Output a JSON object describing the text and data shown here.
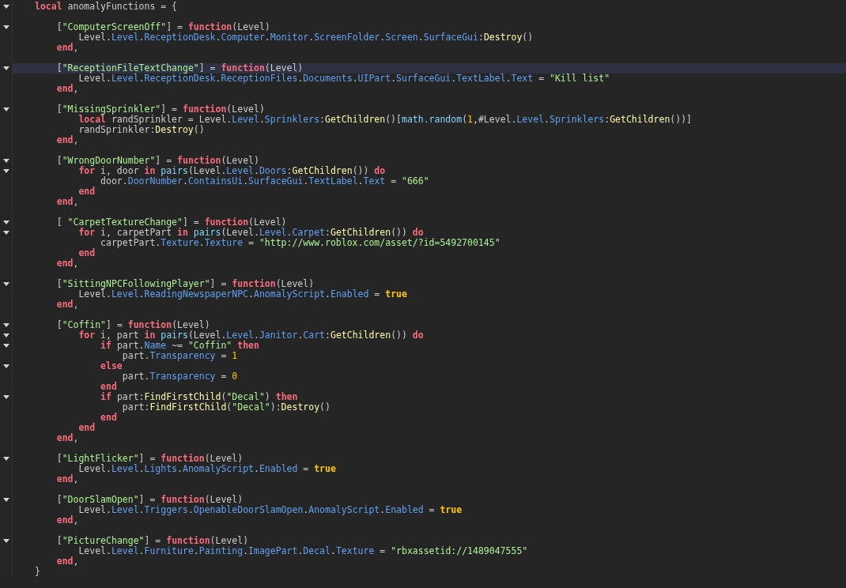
{
  "editor": {
    "lines": [
      {
        "fold": true,
        "current": false,
        "tokens": [
          {
            "kind": "keyword",
            "text": "local"
          },
          {
            "kind": "plain",
            "text": " anomalyFunctions = {"
          }
        ]
      },
      {
        "fold": false,
        "current": false
      },
      {
        "fold": true,
        "current": false,
        "tokens": [
          {
            "kind": "plain",
            "text": "\t["
          },
          {
            "kind": "string",
            "text": "\"ComputerScreenOff\""
          },
          {
            "kind": "plain",
            "text": "] = "
          },
          {
            "kind": "keyword",
            "text": "function"
          },
          {
            "kind": "plain",
            "text": "(Level)"
          }
        ]
      },
      {
        "fold": false,
        "current": false,
        "tokens": [
          {
            "kind": "plain",
            "text": "\t\tLevel."
          },
          {
            "kind": "property",
            "text": "Level"
          },
          {
            "kind": "plain",
            "text": "."
          },
          {
            "kind": "property",
            "text": "ReceptionDesk"
          },
          {
            "kind": "plain",
            "text": "."
          },
          {
            "kind": "property",
            "text": "Computer"
          },
          {
            "kind": "plain",
            "text": "."
          },
          {
            "kind": "property",
            "text": "Monitor"
          },
          {
            "kind": "plain",
            "text": "."
          },
          {
            "kind": "property",
            "text": "ScreenFolder"
          },
          {
            "kind": "plain",
            "text": "."
          },
          {
            "kind": "property",
            "text": "Screen"
          },
          {
            "kind": "plain",
            "text": "."
          },
          {
            "kind": "property",
            "text": "SurfaceGui"
          },
          {
            "kind": "plain",
            "text": ":"
          },
          {
            "kind": "method",
            "text": "Destroy"
          },
          {
            "kind": "plain",
            "text": "()"
          }
        ]
      },
      {
        "fold": false,
        "current": false,
        "tokens": [
          {
            "kind": "keyword",
            "text": "\tend"
          },
          {
            "kind": "plain",
            "text": ","
          }
        ]
      },
      {
        "fold": false,
        "current": false
      },
      {
        "fold": true,
        "current": true,
        "tokens": [
          {
            "kind": "plain",
            "text": "\t["
          },
          {
            "kind": "string",
            "text": "\"ReceptionFileTextChange\""
          },
          {
            "kind": "plain",
            "text": "] = "
          },
          {
            "kind": "keyword",
            "text": "function"
          },
          {
            "kind": "plain",
            "text": "(Level)"
          }
        ]
      },
      {
        "fold": false,
        "current": false,
        "tokens": [
          {
            "kind": "plain",
            "text": "\t\tLevel."
          },
          {
            "kind": "property",
            "text": "Level"
          },
          {
            "kind": "plain",
            "text": "."
          },
          {
            "kind": "property",
            "text": "ReceptionDesk"
          },
          {
            "kind": "plain",
            "text": "."
          },
          {
            "kind": "property",
            "text": "ReceptionFiles"
          },
          {
            "kind": "plain",
            "text": "."
          },
          {
            "kind": "property",
            "text": "Documents"
          },
          {
            "kind": "plain",
            "text": "."
          },
          {
            "kind": "property",
            "text": "UIPart"
          },
          {
            "kind": "plain",
            "text": "."
          },
          {
            "kind": "property",
            "text": "SurfaceGui"
          },
          {
            "kind": "plain",
            "text": "."
          },
          {
            "kind": "property",
            "text": "TextLabel"
          },
          {
            "kind": "plain",
            "text": "."
          },
          {
            "kind": "property",
            "text": "Text"
          },
          {
            "kind": "plain",
            "text": " = "
          },
          {
            "kind": "string",
            "text": "\"Kill list\""
          }
        ]
      },
      {
        "fold": false,
        "current": false,
        "tokens": [
          {
            "kind": "keyword",
            "text": "\tend"
          },
          {
            "kind": "plain",
            "text": ","
          }
        ]
      },
      {
        "fold": false,
        "current": false
      },
      {
        "fold": true,
        "current": false,
        "tokens": [
          {
            "kind": "plain",
            "text": "\t["
          },
          {
            "kind": "string",
            "text": "\"MissingSprinkler\""
          },
          {
            "kind": "plain",
            "text": "] = "
          },
          {
            "kind": "keyword",
            "text": "function"
          },
          {
            "kind": "plain",
            "text": "(Level)"
          }
        ]
      },
      {
        "fold": false,
        "current": false,
        "tokens": [
          {
            "kind": "keyword",
            "text": "\t\tlocal"
          },
          {
            "kind": "plain",
            "text": " randSprinkler = Level."
          },
          {
            "kind": "property",
            "text": "Level"
          },
          {
            "kind": "plain",
            "text": "."
          },
          {
            "kind": "property",
            "text": "Sprinklers"
          },
          {
            "kind": "plain",
            "text": ":"
          },
          {
            "kind": "method",
            "text": "GetChildren"
          },
          {
            "kind": "plain",
            "text": "()["
          },
          {
            "kind": "builtin",
            "text": "math.random"
          },
          {
            "kind": "plain",
            "text": "("
          },
          {
            "kind": "number",
            "text": "1"
          },
          {
            "kind": "plain",
            "text": ",#Level."
          },
          {
            "kind": "property",
            "text": "Level"
          },
          {
            "kind": "plain",
            "text": "."
          },
          {
            "kind": "property",
            "text": "Sprinklers"
          },
          {
            "kind": "plain",
            "text": ":"
          },
          {
            "kind": "method",
            "text": "GetChildren"
          },
          {
            "kind": "plain",
            "text": "())]"
          }
        ]
      },
      {
        "fold": false,
        "current": false,
        "tokens": [
          {
            "kind": "plain",
            "text": "\t\trandSprinkler:"
          },
          {
            "kind": "method",
            "text": "Destroy"
          },
          {
            "kind": "plain",
            "text": "()"
          }
        ]
      },
      {
        "fold": false,
        "current": false,
        "tokens": [
          {
            "kind": "keyword",
            "text": "\tend"
          },
          {
            "kind": "plain",
            "text": ","
          }
        ]
      },
      {
        "fold": false,
        "current": false
      },
      {
        "fold": true,
        "current": false,
        "tokens": [
          {
            "kind": "plain",
            "text": "\t["
          },
          {
            "kind": "string",
            "text": "\"WrongDoorNumber\""
          },
          {
            "kind": "plain",
            "text": "] = "
          },
          {
            "kind": "keyword",
            "text": "function"
          },
          {
            "kind": "plain",
            "text": "(Level)"
          }
        ]
      },
      {
        "fold": true,
        "current": false,
        "tokens": [
          {
            "kind": "keyword",
            "text": "\t\tfor"
          },
          {
            "kind": "plain",
            "text": " i, door "
          },
          {
            "kind": "keyword",
            "text": "in"
          },
          {
            "kind": "builtin",
            "text": " pairs"
          },
          {
            "kind": "plain",
            "text": "(Level."
          },
          {
            "kind": "property",
            "text": "Level"
          },
          {
            "kind": "plain",
            "text": "."
          },
          {
            "kind": "property",
            "text": "Doors"
          },
          {
            "kind": "plain",
            "text": ":"
          },
          {
            "kind": "method",
            "text": "GetChildren"
          },
          {
            "kind": "plain",
            "text": "()) "
          },
          {
            "kind": "keyword",
            "text": "do"
          }
        ]
      },
      {
        "fold": false,
        "current": false,
        "tokens": [
          {
            "kind": "plain",
            "text": "\t\t\tdoor."
          },
          {
            "kind": "property",
            "text": "DoorNumber"
          },
          {
            "kind": "plain",
            "text": "."
          },
          {
            "kind": "property",
            "text": "ContainsUi"
          },
          {
            "kind": "plain",
            "text": "."
          },
          {
            "kind": "property",
            "text": "SurfaceGui"
          },
          {
            "kind": "plain",
            "text": "."
          },
          {
            "kind": "property",
            "text": "TextLabel"
          },
          {
            "kind": "plain",
            "text": "."
          },
          {
            "kind": "property",
            "text": "Text"
          },
          {
            "kind": "plain",
            "text": " = "
          },
          {
            "kind": "string",
            "text": "\"666\""
          }
        ]
      },
      {
        "fold": false,
        "current": false,
        "tokens": [
          {
            "kind": "keyword",
            "text": "\t\tend"
          }
        ]
      },
      {
        "fold": false,
        "current": false,
        "tokens": [
          {
            "kind": "keyword",
            "text": "\tend"
          },
          {
            "kind": "plain",
            "text": ","
          }
        ]
      },
      {
        "fold": false,
        "current": false
      },
      {
        "fold": true,
        "current": false,
        "tokens": [
          {
            "kind": "plain",
            "text": "\t[ "
          },
          {
            "kind": "string",
            "text": "\"CarpetTextureChange\""
          },
          {
            "kind": "plain",
            "text": "] = "
          },
          {
            "kind": "keyword",
            "text": "function"
          },
          {
            "kind": "plain",
            "text": "(Level)"
          }
        ]
      },
      {
        "fold": true,
        "current": false,
        "tokens": [
          {
            "kind": "keyword",
            "text": "\t\tfor"
          },
          {
            "kind": "plain",
            "text": " i, carpetPart "
          },
          {
            "kind": "keyword",
            "text": "in"
          },
          {
            "kind": "builtin",
            "text": " pairs"
          },
          {
            "kind": "plain",
            "text": "(Level."
          },
          {
            "kind": "property",
            "text": "Level"
          },
          {
            "kind": "plain",
            "text": "."
          },
          {
            "kind": "property",
            "text": "Carpet"
          },
          {
            "kind": "plain",
            "text": ":"
          },
          {
            "kind": "method",
            "text": "GetChildren"
          },
          {
            "kind": "plain",
            "text": "()) "
          },
          {
            "kind": "keyword",
            "text": "do"
          }
        ]
      },
      {
        "fold": false,
        "current": false,
        "tokens": [
          {
            "kind": "plain",
            "text": "\t\t\tcarpetPart."
          },
          {
            "kind": "property",
            "text": "Texture"
          },
          {
            "kind": "plain",
            "text": "."
          },
          {
            "kind": "property",
            "text": "Texture"
          },
          {
            "kind": "plain",
            "text": " = "
          },
          {
            "kind": "string",
            "text": "\"http://www.roblox.com/asset/?id=5492700145\""
          }
        ]
      },
      {
        "fold": false,
        "current": false,
        "tokens": [
          {
            "kind": "keyword",
            "text": "\t\tend"
          }
        ]
      },
      {
        "fold": false,
        "current": false,
        "tokens": [
          {
            "kind": "keyword",
            "text": "\tend"
          },
          {
            "kind": "plain",
            "text": ","
          }
        ]
      },
      {
        "fold": false,
        "current": false
      },
      {
        "fold": true,
        "current": false,
        "tokens": [
          {
            "kind": "plain",
            "text": "\t["
          },
          {
            "kind": "string",
            "text": "\"SittingNPCFollowingPlayer\""
          },
          {
            "kind": "plain",
            "text": "] = "
          },
          {
            "kind": "keyword",
            "text": "function"
          },
          {
            "kind": "plain",
            "text": "(Level)"
          }
        ]
      },
      {
        "fold": false,
        "current": false,
        "tokens": [
          {
            "kind": "plain",
            "text": "\t\tLevel."
          },
          {
            "kind": "property",
            "text": "Level"
          },
          {
            "kind": "plain",
            "text": "."
          },
          {
            "kind": "property",
            "text": "ReadingNewspaperNPC"
          },
          {
            "kind": "plain",
            "text": "."
          },
          {
            "kind": "property",
            "text": "AnomalyScript"
          },
          {
            "kind": "plain",
            "text": "."
          },
          {
            "kind": "property",
            "text": "Enabled"
          },
          {
            "kind": "plain",
            "text": " = "
          },
          {
            "kind": "boolean",
            "text": "true"
          }
        ]
      },
      {
        "fold": false,
        "current": false,
        "tokens": [
          {
            "kind": "keyword",
            "text": "\tend"
          },
          {
            "kind": "plain",
            "text": ","
          }
        ]
      },
      {
        "fold": false,
        "current": false
      },
      {
        "fold": true,
        "current": false,
        "tokens": [
          {
            "kind": "plain",
            "text": "\t["
          },
          {
            "kind": "string",
            "text": "\"Coffin\""
          },
          {
            "kind": "plain",
            "text": "] = "
          },
          {
            "kind": "keyword",
            "text": "function"
          },
          {
            "kind": "plain",
            "text": "(Level)"
          }
        ]
      },
      {
        "fold": true,
        "current": false,
        "tokens": [
          {
            "kind": "keyword",
            "text": "\t\tfor"
          },
          {
            "kind": "plain",
            "text": " i, part "
          },
          {
            "kind": "keyword",
            "text": "in"
          },
          {
            "kind": "builtin",
            "text": " pairs"
          },
          {
            "kind": "plain",
            "text": "(Level."
          },
          {
            "kind": "property",
            "text": "Level"
          },
          {
            "kind": "plain",
            "text": "."
          },
          {
            "kind": "property",
            "text": "Janitor"
          },
          {
            "kind": "plain",
            "text": "."
          },
          {
            "kind": "property",
            "text": "Cart"
          },
          {
            "kind": "plain",
            "text": ":"
          },
          {
            "kind": "method",
            "text": "GetChildren"
          },
          {
            "kind": "plain",
            "text": "()) "
          },
          {
            "kind": "keyword",
            "text": "do"
          }
        ]
      },
      {
        "fold": true,
        "current": false,
        "tokens": [
          {
            "kind": "keyword",
            "text": "\t\t\tif"
          },
          {
            "kind": "plain",
            "text": " part."
          },
          {
            "kind": "property",
            "text": "Name"
          },
          {
            "kind": "plain",
            "text": " ~= "
          },
          {
            "kind": "string",
            "text": "\"Coffin\""
          },
          {
            "kind": "keyword",
            "text": " then"
          }
        ]
      },
      {
        "fold": false,
        "current": false,
        "tokens": [
          {
            "kind": "plain",
            "text": "\t\t\t\tpart."
          },
          {
            "kind": "property",
            "text": "Transparency"
          },
          {
            "kind": "plain",
            "text": " = "
          },
          {
            "kind": "number",
            "text": "1"
          }
        ]
      },
      {
        "fold": true,
        "current": false,
        "tokens": [
          {
            "kind": "keyword",
            "text": "\t\t\telse"
          }
        ]
      },
      {
        "fold": false,
        "current": false,
        "tokens": [
          {
            "kind": "plain",
            "text": "\t\t\t\tpart."
          },
          {
            "kind": "property",
            "text": "Transparency"
          },
          {
            "kind": "plain",
            "text": " = "
          },
          {
            "kind": "number",
            "text": "0"
          }
        ]
      },
      {
        "fold": false,
        "current": false,
        "tokens": [
          {
            "kind": "keyword",
            "text": "\t\t\tend"
          }
        ]
      },
      {
        "fold": true,
        "current": false,
        "tokens": [
          {
            "kind": "keyword",
            "text": "\t\t\tif"
          },
          {
            "kind": "plain",
            "text": " part:"
          },
          {
            "kind": "method",
            "text": "FindFirstChild"
          },
          {
            "kind": "plain",
            "text": "("
          },
          {
            "kind": "string",
            "text": "\"Decal\""
          },
          {
            "kind": "plain",
            "text": ") "
          },
          {
            "kind": "keyword",
            "text": "then"
          }
        ]
      },
      {
        "fold": false,
        "current": false,
        "tokens": [
          {
            "kind": "plain",
            "text": "\t\t\t\tpart:"
          },
          {
            "kind": "method",
            "text": "FindFirstChild"
          },
          {
            "kind": "plain",
            "text": "("
          },
          {
            "kind": "string",
            "text": "\"Decal\""
          },
          {
            "kind": "plain",
            "text": "):"
          },
          {
            "kind": "method",
            "text": "Destroy"
          },
          {
            "kind": "plain",
            "text": "()"
          }
        ]
      },
      {
        "fold": false,
        "current": false,
        "tokens": [
          {
            "kind": "keyword",
            "text": "\t\t\tend"
          }
        ]
      },
      {
        "fold": false,
        "current": false,
        "tokens": [
          {
            "kind": "keyword",
            "text": "\t\tend"
          }
        ]
      },
      {
        "fold": false,
        "current": false,
        "tokens": [
          {
            "kind": "keyword",
            "text": "\tend"
          },
          {
            "kind": "plain",
            "text": ","
          }
        ]
      },
      {
        "fold": false,
        "current": false
      },
      {
        "fold": true,
        "current": false,
        "tokens": [
          {
            "kind": "plain",
            "text": "\t["
          },
          {
            "kind": "string",
            "text": "\"LightFlicker\""
          },
          {
            "kind": "plain",
            "text": "] = "
          },
          {
            "kind": "keyword",
            "text": "function"
          },
          {
            "kind": "plain",
            "text": "(Level)"
          }
        ]
      },
      {
        "fold": false,
        "current": false,
        "tokens": [
          {
            "kind": "plain",
            "text": "\t\tLevel."
          },
          {
            "kind": "property",
            "text": "Level"
          },
          {
            "kind": "plain",
            "text": "."
          },
          {
            "kind": "property",
            "text": "Lights"
          },
          {
            "kind": "plain",
            "text": "."
          },
          {
            "kind": "property",
            "text": "AnomalyScript"
          },
          {
            "kind": "plain",
            "text": "."
          },
          {
            "kind": "property",
            "text": "Enabled"
          },
          {
            "kind": "plain",
            "text": " = "
          },
          {
            "kind": "boolean",
            "text": "true"
          }
        ]
      },
      {
        "fold": false,
        "current": false,
        "tokens": [
          {
            "kind": "keyword",
            "text": "\tend"
          },
          {
            "kind": "plain",
            "text": ","
          }
        ]
      },
      {
        "fold": false,
        "current": false
      },
      {
        "fold": true,
        "current": false,
        "tokens": [
          {
            "kind": "plain",
            "text": "\t["
          },
          {
            "kind": "string",
            "text": "\"DoorSlamOpen\""
          },
          {
            "kind": "plain",
            "text": "] = "
          },
          {
            "kind": "keyword",
            "text": "function"
          },
          {
            "kind": "plain",
            "text": "(Level)"
          }
        ]
      },
      {
        "fold": false,
        "current": false,
        "tokens": [
          {
            "kind": "plain",
            "text": "\t\tLevel."
          },
          {
            "kind": "property",
            "text": "Level"
          },
          {
            "kind": "plain",
            "text": "."
          },
          {
            "kind": "property",
            "text": "Triggers"
          },
          {
            "kind": "plain",
            "text": "."
          },
          {
            "kind": "property",
            "text": "OpenableDoorSlamOpen"
          },
          {
            "kind": "plain",
            "text": "."
          },
          {
            "kind": "property",
            "text": "AnomalyScript"
          },
          {
            "kind": "plain",
            "text": "."
          },
          {
            "kind": "property",
            "text": "Enabled"
          },
          {
            "kind": "plain",
            "text": " = "
          },
          {
            "kind": "boolean",
            "text": "true"
          }
        ]
      },
      {
        "fold": false,
        "current": false,
        "tokens": [
          {
            "kind": "keyword",
            "text": "\tend"
          },
          {
            "kind": "plain",
            "text": ","
          }
        ]
      },
      {
        "fold": false,
        "current": false
      },
      {
        "fold": true,
        "current": false,
        "tokens": [
          {
            "kind": "plain",
            "text": "\t["
          },
          {
            "kind": "string",
            "text": "\"PictureChange\""
          },
          {
            "kind": "plain",
            "text": "] = "
          },
          {
            "kind": "keyword",
            "text": "function"
          },
          {
            "kind": "plain",
            "text": "(Level)"
          }
        ]
      },
      {
        "fold": false,
        "current": false,
        "tokens": [
          {
            "kind": "plain",
            "text": "\t\tLevel."
          },
          {
            "kind": "property",
            "text": "Level"
          },
          {
            "kind": "plain",
            "text": "."
          },
          {
            "kind": "property",
            "text": "Furniture"
          },
          {
            "kind": "plain",
            "text": "."
          },
          {
            "kind": "property",
            "text": "Painting"
          },
          {
            "kind": "plain",
            "text": "."
          },
          {
            "kind": "property",
            "text": "ImagePart"
          },
          {
            "kind": "plain",
            "text": "."
          },
          {
            "kind": "property",
            "text": "Decal"
          },
          {
            "kind": "plain",
            "text": "."
          },
          {
            "kind": "property",
            "text": "Texture"
          },
          {
            "kind": "plain",
            "text": " = "
          },
          {
            "kind": "string",
            "text": "\"rbxassetid://1489047555\""
          }
        ]
      },
      {
        "fold": false,
        "current": false,
        "tokens": [
          {
            "kind": "keyword",
            "text": "\tend"
          },
          {
            "kind": "plain",
            "text": ","
          }
        ]
      },
      {
        "fold": false,
        "current": false,
        "tokens": [
          {
            "kind": "plain",
            "text": "}"
          }
        ]
      }
    ]
  }
}
